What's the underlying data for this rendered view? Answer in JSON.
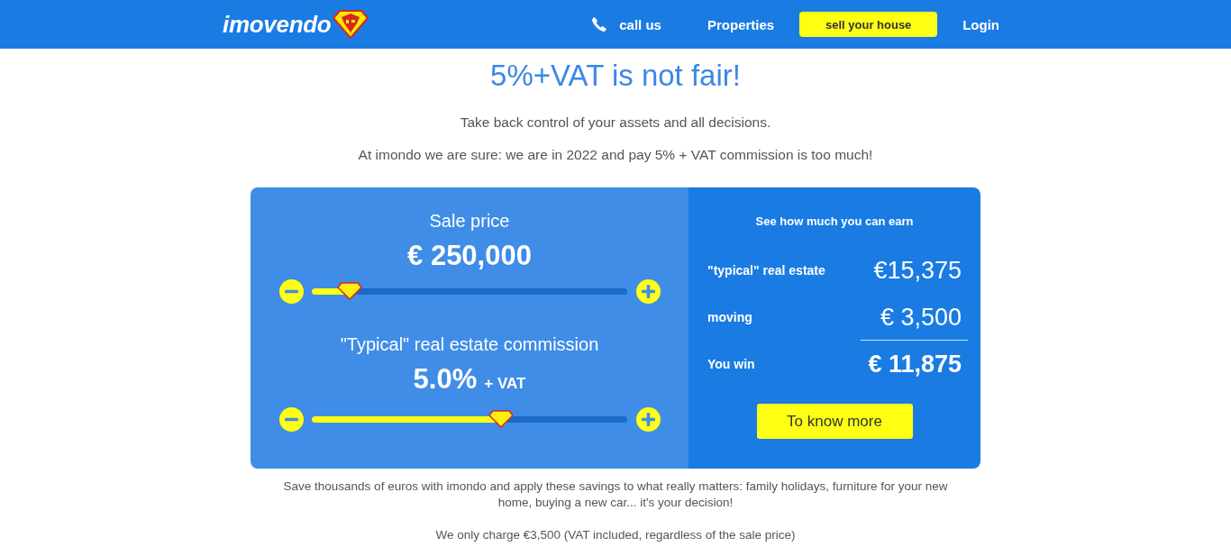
{
  "header": {
    "logo": "imovendo",
    "nav": [
      {
        "kind": "phone",
        "label": "call us"
      },
      {
        "kind": "link",
        "label": "Properties"
      },
      {
        "kind": "cta",
        "label": "sell your house"
      },
      {
        "kind": "link",
        "label": "Login"
      }
    ]
  },
  "hero": {
    "title": "5%+VAT is not fair!",
    "lines": [
      "Take back control of your assets and all decisions.",
      "At imondo we are sure: we are in 2022 and pay 5% + VAT commission is too much!"
    ]
  },
  "calculator": {
    "sliders": [
      {
        "label": "Sale price",
        "value": "€ 250,000",
        "level": 0.12
      },
      {
        "label": "\"Typical\" real estate commission",
        "value": "5.0%",
        "suffix": "+ VAT",
        "level": 0.6
      }
    ],
    "summary": {
      "title": "See how much you can earn",
      "rows": [
        {
          "kind": "item",
          "label": "\"typical\" real estate",
          "value": "€15,375"
        },
        {
          "kind": "item",
          "label": "moving",
          "value": "€ 3,500"
        },
        {
          "kind": "total",
          "label": "You win",
          "value": "€ 11,875"
        }
      ],
      "button": "To know more"
    }
  },
  "notes": [
    "Save thousands of euros with imondo and apply these savings to what really matters: family holidays, furniture for your new home, buying a new car... it's your decision!",
    "We only charge €3,500 (VAT included, regardless of the sale price)"
  ]
}
